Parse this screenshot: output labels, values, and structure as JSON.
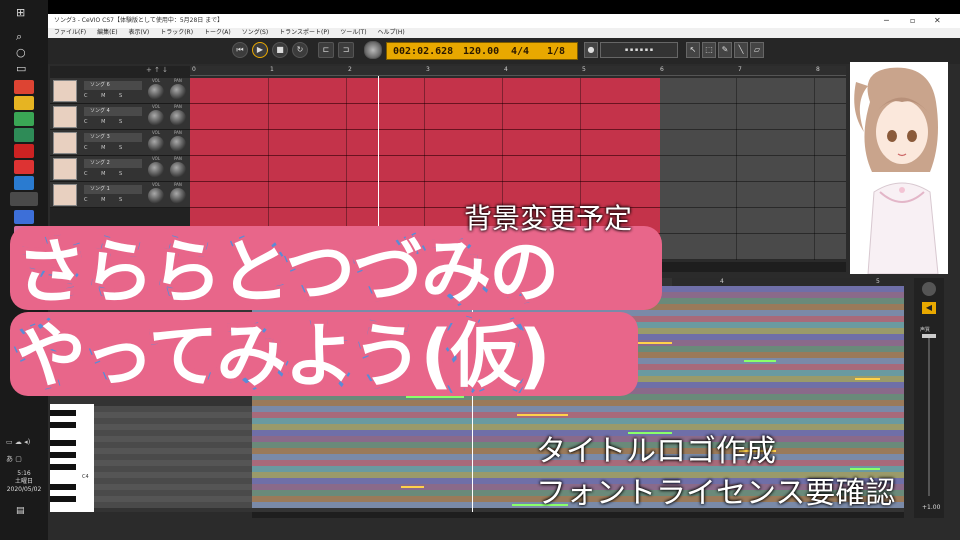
{
  "taskbar": {
    "clock_time": "5:16",
    "clock_day": "土曜日",
    "clock_date": "2020/05/02",
    "ime": "あ"
  },
  "window": {
    "title": "ソング3 - CeVIO CS7【体験版として使用中：5月28日 まで】",
    "menu": [
      "ファイル(F)",
      "編集(E)",
      "表示(V)",
      "トラック(R)",
      "トーク(A)",
      "ソング(S)",
      "トランスポート(P)",
      "ツール(T)",
      "ヘルプ(H)"
    ]
  },
  "transport": {
    "time": "002:02.628",
    "tempo": "120.00",
    "beat": "4/4",
    "quantize": "1/8"
  },
  "ruler": [
    "0",
    "1",
    "2",
    "3",
    "4",
    "5",
    "6",
    "7",
    "8"
  ],
  "tracks": [
    {
      "name": "ソング 6"
    },
    {
      "name": "ソング 4"
    },
    {
      "name": "ソング 3"
    },
    {
      "name": "ソング 2"
    },
    {
      "name": "ソング 1"
    }
  ],
  "track_labels": {
    "vol": "VOL",
    "pan": "PAN",
    "opts": "C M S"
  },
  "pianoroll": {
    "ruler": [
      "4",
      "5"
    ],
    "key_label": "C4",
    "zoom": "+1.00",
    "voice_label": "声質"
  },
  "overlay": {
    "title_line1": "さららとつづみの",
    "title_line2": "やってみよう(仮)",
    "note_bg": "背景変更予定",
    "note_logo": "タイトルロゴ作成",
    "note_font": "フォントライセンス要確認"
  },
  "colors": {
    "lane_red": "#c4334a",
    "title_outline_blue": "#5a8bd6",
    "title_pink": "#e8668a",
    "lcd_amber": "#e8a800"
  }
}
